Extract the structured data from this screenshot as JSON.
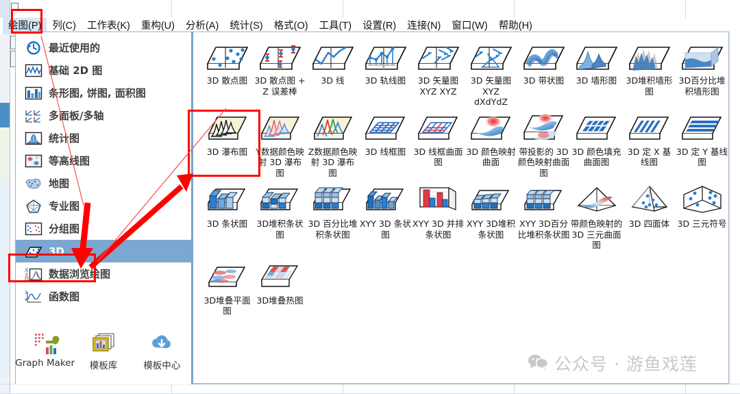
{
  "menubar": {
    "items": [
      {
        "label": "绘图(P)",
        "active": true
      },
      {
        "label": "列(C)",
        "active": false
      },
      {
        "label": "工作表(K)",
        "active": false
      },
      {
        "label": "重构(U)",
        "active": false
      },
      {
        "label": "分析(A)",
        "active": false
      },
      {
        "label": "统计(S)",
        "active": false
      },
      {
        "label": "格式(O)",
        "active": false
      },
      {
        "label": "工具(T)",
        "active": false
      },
      {
        "label": "设置(R)",
        "active": false
      },
      {
        "label": "连接(N)",
        "active": false
      },
      {
        "label": "窗口(W)",
        "active": false
      },
      {
        "label": "帮助(H)",
        "active": false
      }
    ]
  },
  "sidebar": {
    "items": [
      {
        "label": "最近使用的",
        "icon": "recent-clock-icon",
        "selected": false
      },
      {
        "label": "基础 2D 图",
        "icon": "line-2d-icon",
        "selected": false
      },
      {
        "label": "条形图, 饼图, 面积图",
        "icon": "bar-chart-icon",
        "selected": false
      },
      {
        "label": "多面板/多轴",
        "icon": "multipanel-icon",
        "selected": false
      },
      {
        "label": "统计图",
        "icon": "statistics-icon",
        "selected": false
      },
      {
        "label": "等高线图",
        "icon": "contour-icon",
        "selected": false
      },
      {
        "label": "地图",
        "icon": "map-icon",
        "selected": false
      },
      {
        "label": "专业图",
        "icon": "specialized-icon",
        "selected": false
      },
      {
        "label": "分组图",
        "icon": "grouped-icon",
        "selected": false
      },
      {
        "label": "3D",
        "icon": "cube-3d-icon",
        "selected": true
      },
      {
        "label": "数据浏览绘图",
        "icon": "data-explore-icon",
        "selected": false
      },
      {
        "label": "函数图",
        "icon": "function-plot-icon",
        "selected": false
      }
    ],
    "bottom_buttons": [
      {
        "label": "Graph Maker",
        "icon": "graph-maker-icon"
      },
      {
        "label": "模板库",
        "icon": "template-library-icon"
      },
      {
        "label": "模板中心",
        "icon": "template-center-cloud-icon"
      }
    ]
  },
  "grid": {
    "rows": [
      [
        {
          "label": "3D 散点图",
          "thumb": "scatter3d"
        },
        {
          "label": "3D 散点图 + Z 误差棒",
          "thumb": "scatter3d-err"
        },
        {
          "label": "3D 线",
          "thumb": "line3d"
        },
        {
          "label": "3D 轨线图",
          "thumb": "traj3d"
        },
        {
          "label": "3D 矢量图 XYZ XYZ",
          "thumb": "vector3d-a"
        },
        {
          "label": "3D 矢量图 XYZ dXdYdZ",
          "thumb": "vector3d-b"
        },
        {
          "label": "3D 带状图",
          "thumb": "ribbon3d"
        },
        {
          "label": "3D 墙形图",
          "thumb": "wall3d"
        },
        {
          "label": "3D堆积墙形图",
          "thumb": "stackwall3d"
        },
        {
          "label": "3D百分比堆积墙形图",
          "thumb": "pctwall3d"
        }
      ],
      [
        {
          "label": "3D 瀑布图",
          "thumb": "waterfall3d",
          "highlighted": true
        },
        {
          "label": "Y数据颜色映射 3D 瀑布图",
          "thumb": "waterfall-y"
        },
        {
          "label": "Z数据颜色映射 3D 瀑布图",
          "thumb": "waterfall-z"
        },
        {
          "label": "3D 线框图",
          "thumb": "wireframe3d"
        },
        {
          "label": "3D 线框曲面图",
          "thumb": "wireframe-surf"
        },
        {
          "label": "3D 颜色映射曲面",
          "thumb": "colormap-surf"
        },
        {
          "label": "带投影的 3D 颜色映射曲面图",
          "thumb": "proj-colormap"
        },
        {
          "label": "3D 颜色填充曲面图",
          "thumb": "colorfill-surf"
        },
        {
          "label": "3D 定 X 基线图",
          "thumb": "xbaseline"
        },
        {
          "label": "3D 定 Y 基线图",
          "thumb": "ybaseline"
        }
      ],
      [
        {
          "label": "3D 条状图",
          "thumb": "bar3d"
        },
        {
          "label": "3D堆积条状图",
          "thumb": "stackbar3d"
        },
        {
          "label": "3D 百分比堆积条状图",
          "thumb": "pctbar3d"
        },
        {
          "label": "XYY 3D 条状图",
          "thumb": "xyy-bar3d"
        },
        {
          "label": "XYY 3D 并排条状图",
          "thumb": "xyy-side-bar"
        },
        {
          "label": "XYY 3D堆积条状图",
          "thumb": "xyy-stack-bar"
        },
        {
          "label": "XYY 3D百分比堆积条状图",
          "thumb": "xyy-pct-bar"
        },
        {
          "label": "带颜色映射的 3D 三元曲面图",
          "thumb": "ternary-surf"
        },
        {
          "label": "3D 四面体",
          "thumb": "tetrahedron"
        },
        {
          "label": "3D 三元符号",
          "thumb": "ternary-symbol"
        }
      ],
      [
        {
          "label": "3D堆叠平面图",
          "thumb": "stacked-plane"
        },
        {
          "label": "3D堆叠热图",
          "thumb": "stacked-heat"
        }
      ]
    ]
  },
  "annotations": {
    "menu_box": "red-highlight-box-around-plot-menu",
    "waterfall_box": "red-highlight-box-around-3d-waterfall",
    "sidebar_box": "red-highlight-box-around-3d-item",
    "arrow_down": "red-arrow-pointing-to-3d-sidebar-item",
    "arrow_up": "red-arrow-pointing-to-3d-waterfall"
  },
  "watermark": {
    "text": "公众号 · 游鱼戏莲",
    "icon": "wechat-icon",
    "color": "#c8c8c8"
  },
  "colors": {
    "selection_blue": "#7ba7d0",
    "annotation_red": "#fe0000",
    "divider_blue": "#7aa4cd",
    "menu_active_bg": "#d6e6f4"
  }
}
